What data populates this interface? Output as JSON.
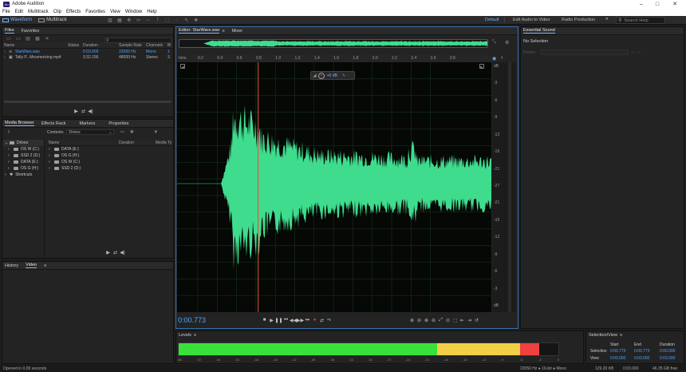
{
  "app": {
    "title": "Adobe Audition",
    "logo_text": "Au"
  },
  "menu": [
    "File",
    "Edit",
    "Multitrack",
    "Clip",
    "Effects",
    "Favorites",
    "View",
    "Window",
    "Help"
  ],
  "toolbar": {
    "waveform_label": "Waveform",
    "multitrack_label": "Multitrack",
    "workspaces": [
      "Default",
      "Edit Audio to Video",
      "Radio Production"
    ],
    "search_placeholder": "Search Help"
  },
  "files_panel": {
    "tabs": [
      "Files",
      "Favorites"
    ],
    "columns": [
      "Name",
      "Status",
      "Duration",
      "Sample Rate",
      "Channels",
      "Bi"
    ],
    "rows": [
      {
        "name": "StarWars.wav",
        "status": "",
        "duration": "0:03.000",
        "sample_rate": "22050 Hz",
        "channels": "Mono",
        "bits": "1",
        "active": true
      },
      {
        "name": "Tally P...Mesmerizing.mp4",
        "status": "",
        "duration": "3:32.156",
        "sample_rate": "48000 Hz",
        "channels": "Stereo",
        "bits": "3",
        "active": false
      }
    ]
  },
  "media_browser": {
    "tabs": [
      "Media Browser",
      "Effects Rack",
      "Markers",
      "Properties"
    ],
    "contents_label": "Contents:",
    "contents_value": "Drives",
    "left_tree": [
      {
        "label": "Drives",
        "type": "root"
      },
      {
        "label": "OS W (C:)",
        "type": "drive"
      },
      {
        "label": "SSD 2 (D:)",
        "type": "drive"
      },
      {
        "label": "DATA (E:)",
        "type": "drive"
      },
      {
        "label": "OS G (H:)",
        "type": "drive"
      },
      {
        "label": "Shortcuts",
        "type": "root"
      }
    ],
    "right_columns": [
      "Name",
      "Duration",
      "Media Ty"
    ],
    "right_items": [
      "DATA (E:)",
      "OS G (H:)",
      "OS W (C:)",
      "SSD 2 (D:)"
    ]
  },
  "history_panel": {
    "tabs": [
      "History",
      "Video"
    ]
  },
  "editor": {
    "tabs": [
      "Editor: StarWars.wav",
      "Mixer"
    ],
    "ruler_unit": "hms",
    "ruler_ticks": [
      "0.2",
      "0.4",
      "0.6",
      "0.8",
      "1.0",
      "1.2",
      "1.4",
      "1.6",
      "1.8",
      "2.0",
      "2.2",
      "2.4",
      "2.6",
      "2.8"
    ],
    "db_scale": [
      "dB",
      "-3",
      "-6",
      "-9",
      "-12",
      "-15",
      "-21",
      "-27",
      "-21",
      "-15",
      "-12",
      "-9",
      "-6",
      "-3",
      "dB"
    ],
    "left_scale": [
      "1",
      "2",
      "3",
      "4",
      "5",
      "6",
      "7",
      "8",
      "9",
      "12",
      "15",
      "21",
      "27",
      "21",
      "15",
      "12",
      "9",
      "6",
      "5",
      "4",
      "3",
      "2",
      "1"
    ],
    "volume_value": "+0 dB",
    "current_time": "0:00.773",
    "playhead_fraction": 0.258,
    "waveform_color": "#3fdc8e"
  },
  "essential_sound": {
    "title": "Essential Sound",
    "status": "No Selection",
    "preset_label": "Preset:"
  },
  "levels": {
    "title": "Levels",
    "scale": [
      "dB",
      "-57",
      "-54",
      "-51",
      "-48",
      "-45",
      "-42",
      "-39",
      "-36",
      "-33",
      "-30",
      "-27",
      "-24",
      "-21",
      "-18",
      "-15",
      "-12",
      "-9",
      "-6",
      "-3",
      "0"
    ],
    "green_fraction": 0.68,
    "yellow_fraction": 0.22,
    "red_fraction": 0.05
  },
  "selection_view": {
    "title": "Selection/View",
    "columns": [
      "Start",
      "End",
      "Duration"
    ],
    "selection": {
      "label": "Selection",
      "start": "0:00.773",
      "end": "0:00.773",
      "duration": "0:00.000"
    },
    "view": {
      "label": "View",
      "start": "0:00.000",
      "end": "0:03.000",
      "duration": "0:03.000"
    }
  },
  "status_bar": {
    "left": "Opened in 0.09 seconds",
    "format": "22050 Hz ● 16-bit ● Mono",
    "size": "129.20 KB",
    "duration": "0:03.000",
    "free": "46.35 GB free"
  }
}
